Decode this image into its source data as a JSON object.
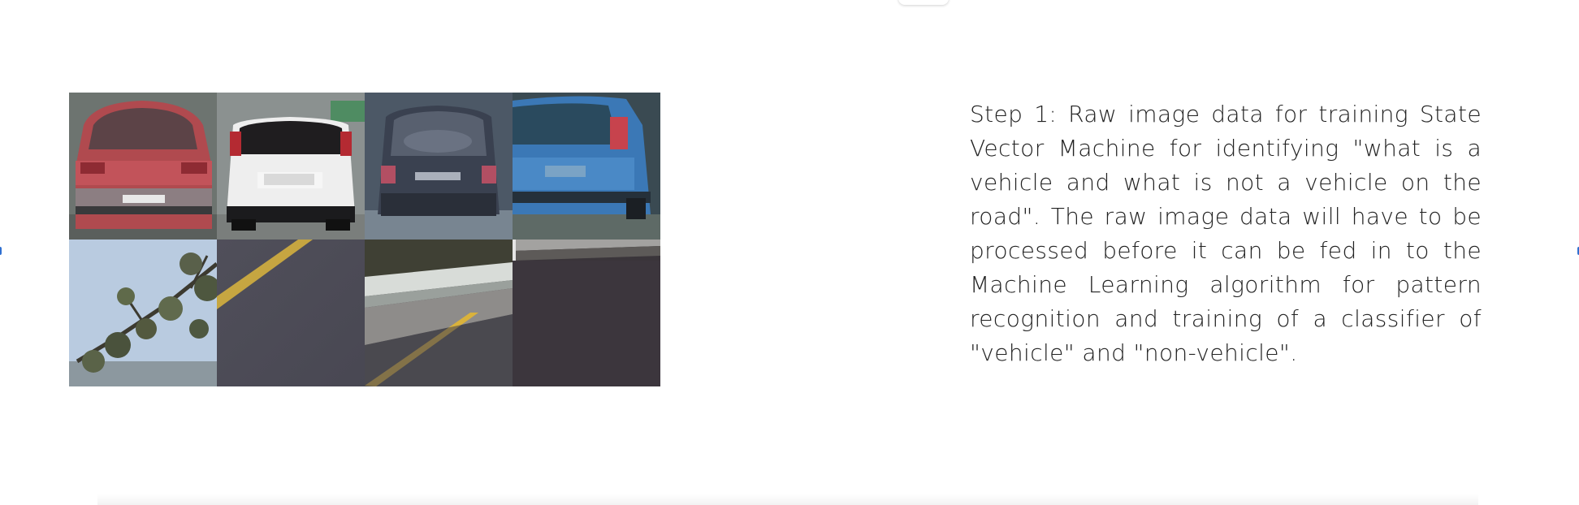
{
  "slide": {
    "description": "Step 1: Raw image data for training State Vector Machine for identifying \"what is a vehicle and what is not a vehicle on the road\". The raw image data will have to be processed before it can be fed in to the Machine Learning algorithm for pattern recognition and training of a classifier of \"vehicle\" and \"non-vehicle\"."
  },
  "tiles": [
    {
      "kind": "vehicle",
      "desc": "red car rear"
    },
    {
      "kind": "vehicle",
      "desc": "white car rear"
    },
    {
      "kind": "vehicle",
      "desc": "dark car rear"
    },
    {
      "kind": "vehicle",
      "desc": "blue car rear"
    },
    {
      "kind": "non-vehicle",
      "desc": "tree branches and sky"
    },
    {
      "kind": "non-vehicle",
      "desc": "road with yellow lane line"
    },
    {
      "kind": "non-vehicle",
      "desc": "guardrail and road"
    },
    {
      "kind": "non-vehicle",
      "desc": "dark road wall"
    }
  ],
  "colors": {
    "accent": "#2f6fd0",
    "text": "#222222"
  }
}
